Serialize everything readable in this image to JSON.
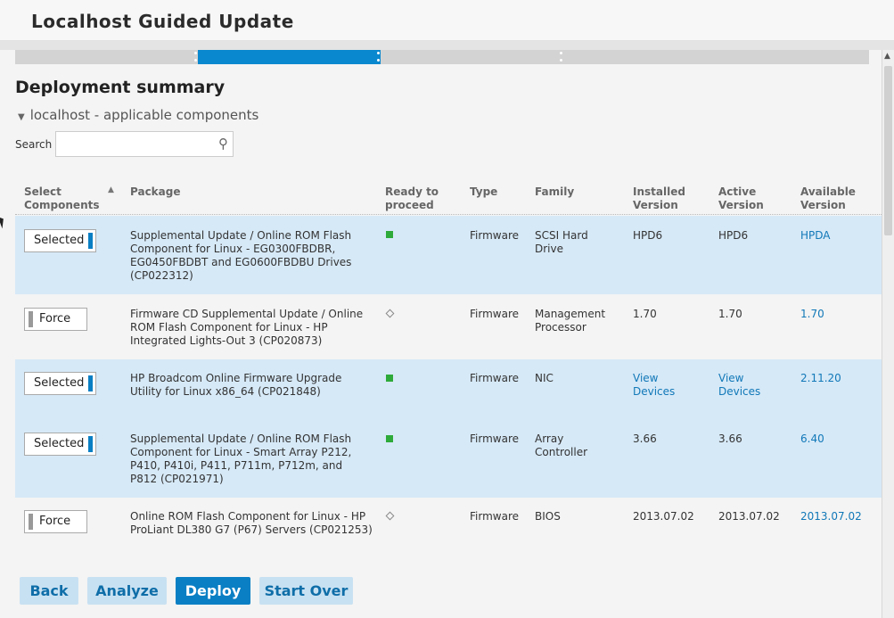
{
  "app": {
    "title": "Localhost Guided Update"
  },
  "page": {
    "heading": "Deployment summary",
    "subheading": "localhost - applicable components",
    "search_label": "Search",
    "search_value": ""
  },
  "table": {
    "headers": {
      "select_line1": "Select",
      "select_line2": "Components",
      "package": "Package",
      "ready_line1": "Ready to",
      "ready_line2": "proceed",
      "type": "Type",
      "family": "Family",
      "installed_line1": "Installed",
      "installed_line2": "Version",
      "active_line1": "Active",
      "active_line2": "Version",
      "available_line1": "Available",
      "available_line2": "Version"
    },
    "rows": [
      {
        "toggle": "Selected",
        "pkg1": "Supplemental Update / Online ROM Flash",
        "pkg2": "Component for Linux - EG0300FBDBR,",
        "pkg3": "EG0450FBDBT and EG0600FBDBU Drives",
        "pkg4": "(CP022312)",
        "type": "Firmware",
        "family1": "SCSI Hard",
        "family2": "Drive",
        "installed1": "HPD6",
        "installed2": "",
        "active1": "HPD6",
        "active2": "",
        "available": "HPDA"
      },
      {
        "toggle": "Force",
        "pkg1": "Firmware CD Supplemental Update / Online",
        "pkg2": "ROM Flash Component for Linux - HP",
        "pkg3": "Integrated Lights-Out 3 (CP020873)",
        "pkg4": "",
        "type": "Firmware",
        "family1": "Management",
        "family2": "Processor",
        "installed1": "1.70",
        "installed2": "",
        "active1": "1.70",
        "active2": "",
        "available": "1.70"
      },
      {
        "toggle": "Selected",
        "pkg1": "HP Broadcom Online Firmware Upgrade",
        "pkg2": "Utility for Linux x86_64 (CP021848)",
        "pkg3": "",
        "pkg4": "",
        "type": "Firmware",
        "family1": "NIC",
        "family2": "",
        "installed1": "View",
        "installed2": "Devices",
        "active1": "View",
        "active2": "Devices",
        "available": "2.11.20"
      },
      {
        "toggle": "Selected",
        "pkg1": "Supplemental Update / Online ROM Flash",
        "pkg2": "Component for Linux - Smart Array P212,",
        "pkg3": "P410, P410i, P411, P711m, P712m, and",
        "pkg4": "P812 (CP021971)",
        "type": "Firmware",
        "family1": "Array",
        "family2": "Controller",
        "installed1": "3.66",
        "installed2": "",
        "active1": "3.66",
        "active2": "",
        "available": "6.40"
      },
      {
        "toggle": "Force",
        "pkg1": "Online ROM Flash Component for Linux - HP",
        "pkg2": "ProLiant DL380 G7 (P67) Servers (CP021253)",
        "pkg3": "",
        "pkg4": "",
        "type": "Firmware",
        "family1": "BIOS",
        "family2": "",
        "installed1": "2013.07.02",
        "installed2": "",
        "active1": "2013.07.02",
        "active2": "",
        "available": "2013.07.02"
      }
    ]
  },
  "footer": {
    "back": "Back",
    "analyze": "Analyze",
    "deploy": "Deploy",
    "start_over": "Start Over"
  },
  "icons": {
    "search": "magnifier-icon",
    "expand": "triangle-down-icon",
    "sort": "sort-up-icon",
    "ready": "green-square-icon",
    "not_ready": "diamond-icon"
  },
  "colors": {
    "accent": "#0a7fc4",
    "selected_row": "#d6e9f7",
    "link": "#1178b8",
    "ready": "#2eaa3a"
  }
}
